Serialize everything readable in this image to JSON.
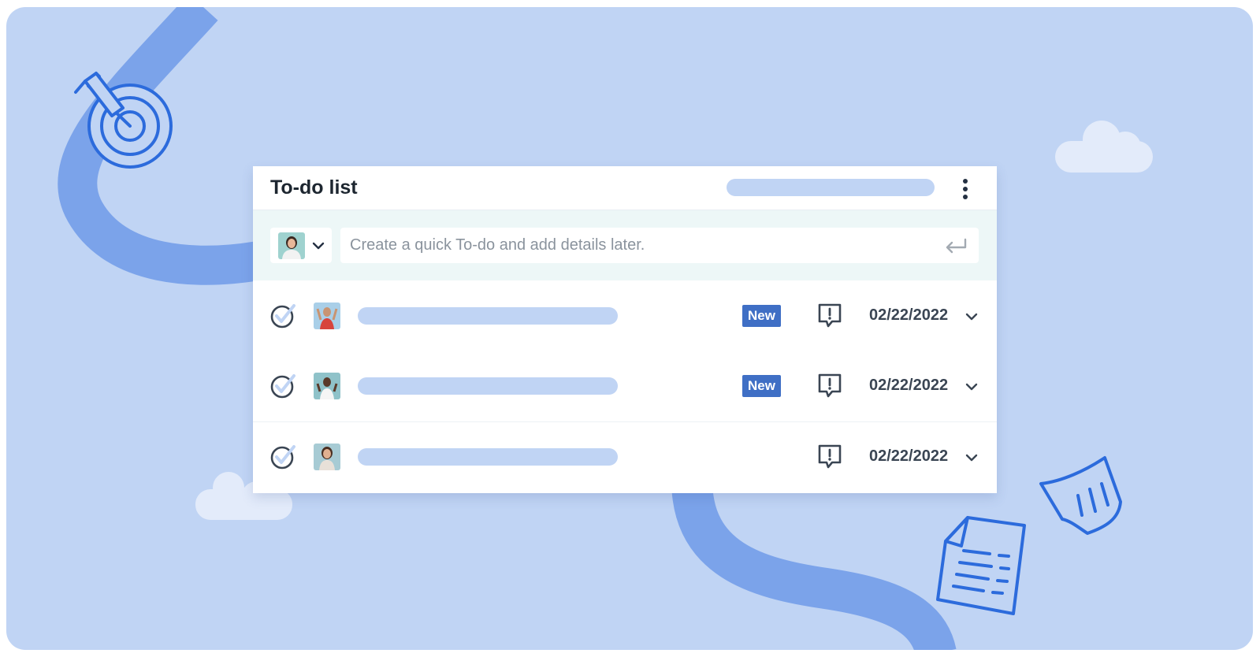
{
  "todo": {
    "title": "To-do list",
    "quick_add": {
      "placeholder": "Create a quick To-do and add details later."
    },
    "tasks": [
      {
        "badge": "New",
        "date": "02/22/2022"
      },
      {
        "badge": "New",
        "date": "02/22/2022"
      },
      {
        "badge": "",
        "date": "02/22/2022"
      }
    ]
  },
  "colors": {
    "background": "#c0d4f4",
    "path": "#7ba3ea",
    "accent": "#3f6fc5",
    "icon_line": "#2c6bdc",
    "quick_bar": "#edf7f7",
    "text_dark": "#1d2630"
  },
  "icons": [
    "target-icon",
    "cloud-icon",
    "document-icon",
    "kebab-menu-icon",
    "chevron-down-icon",
    "enter-icon",
    "check-circle-icon",
    "comment-alert-icon"
  ]
}
